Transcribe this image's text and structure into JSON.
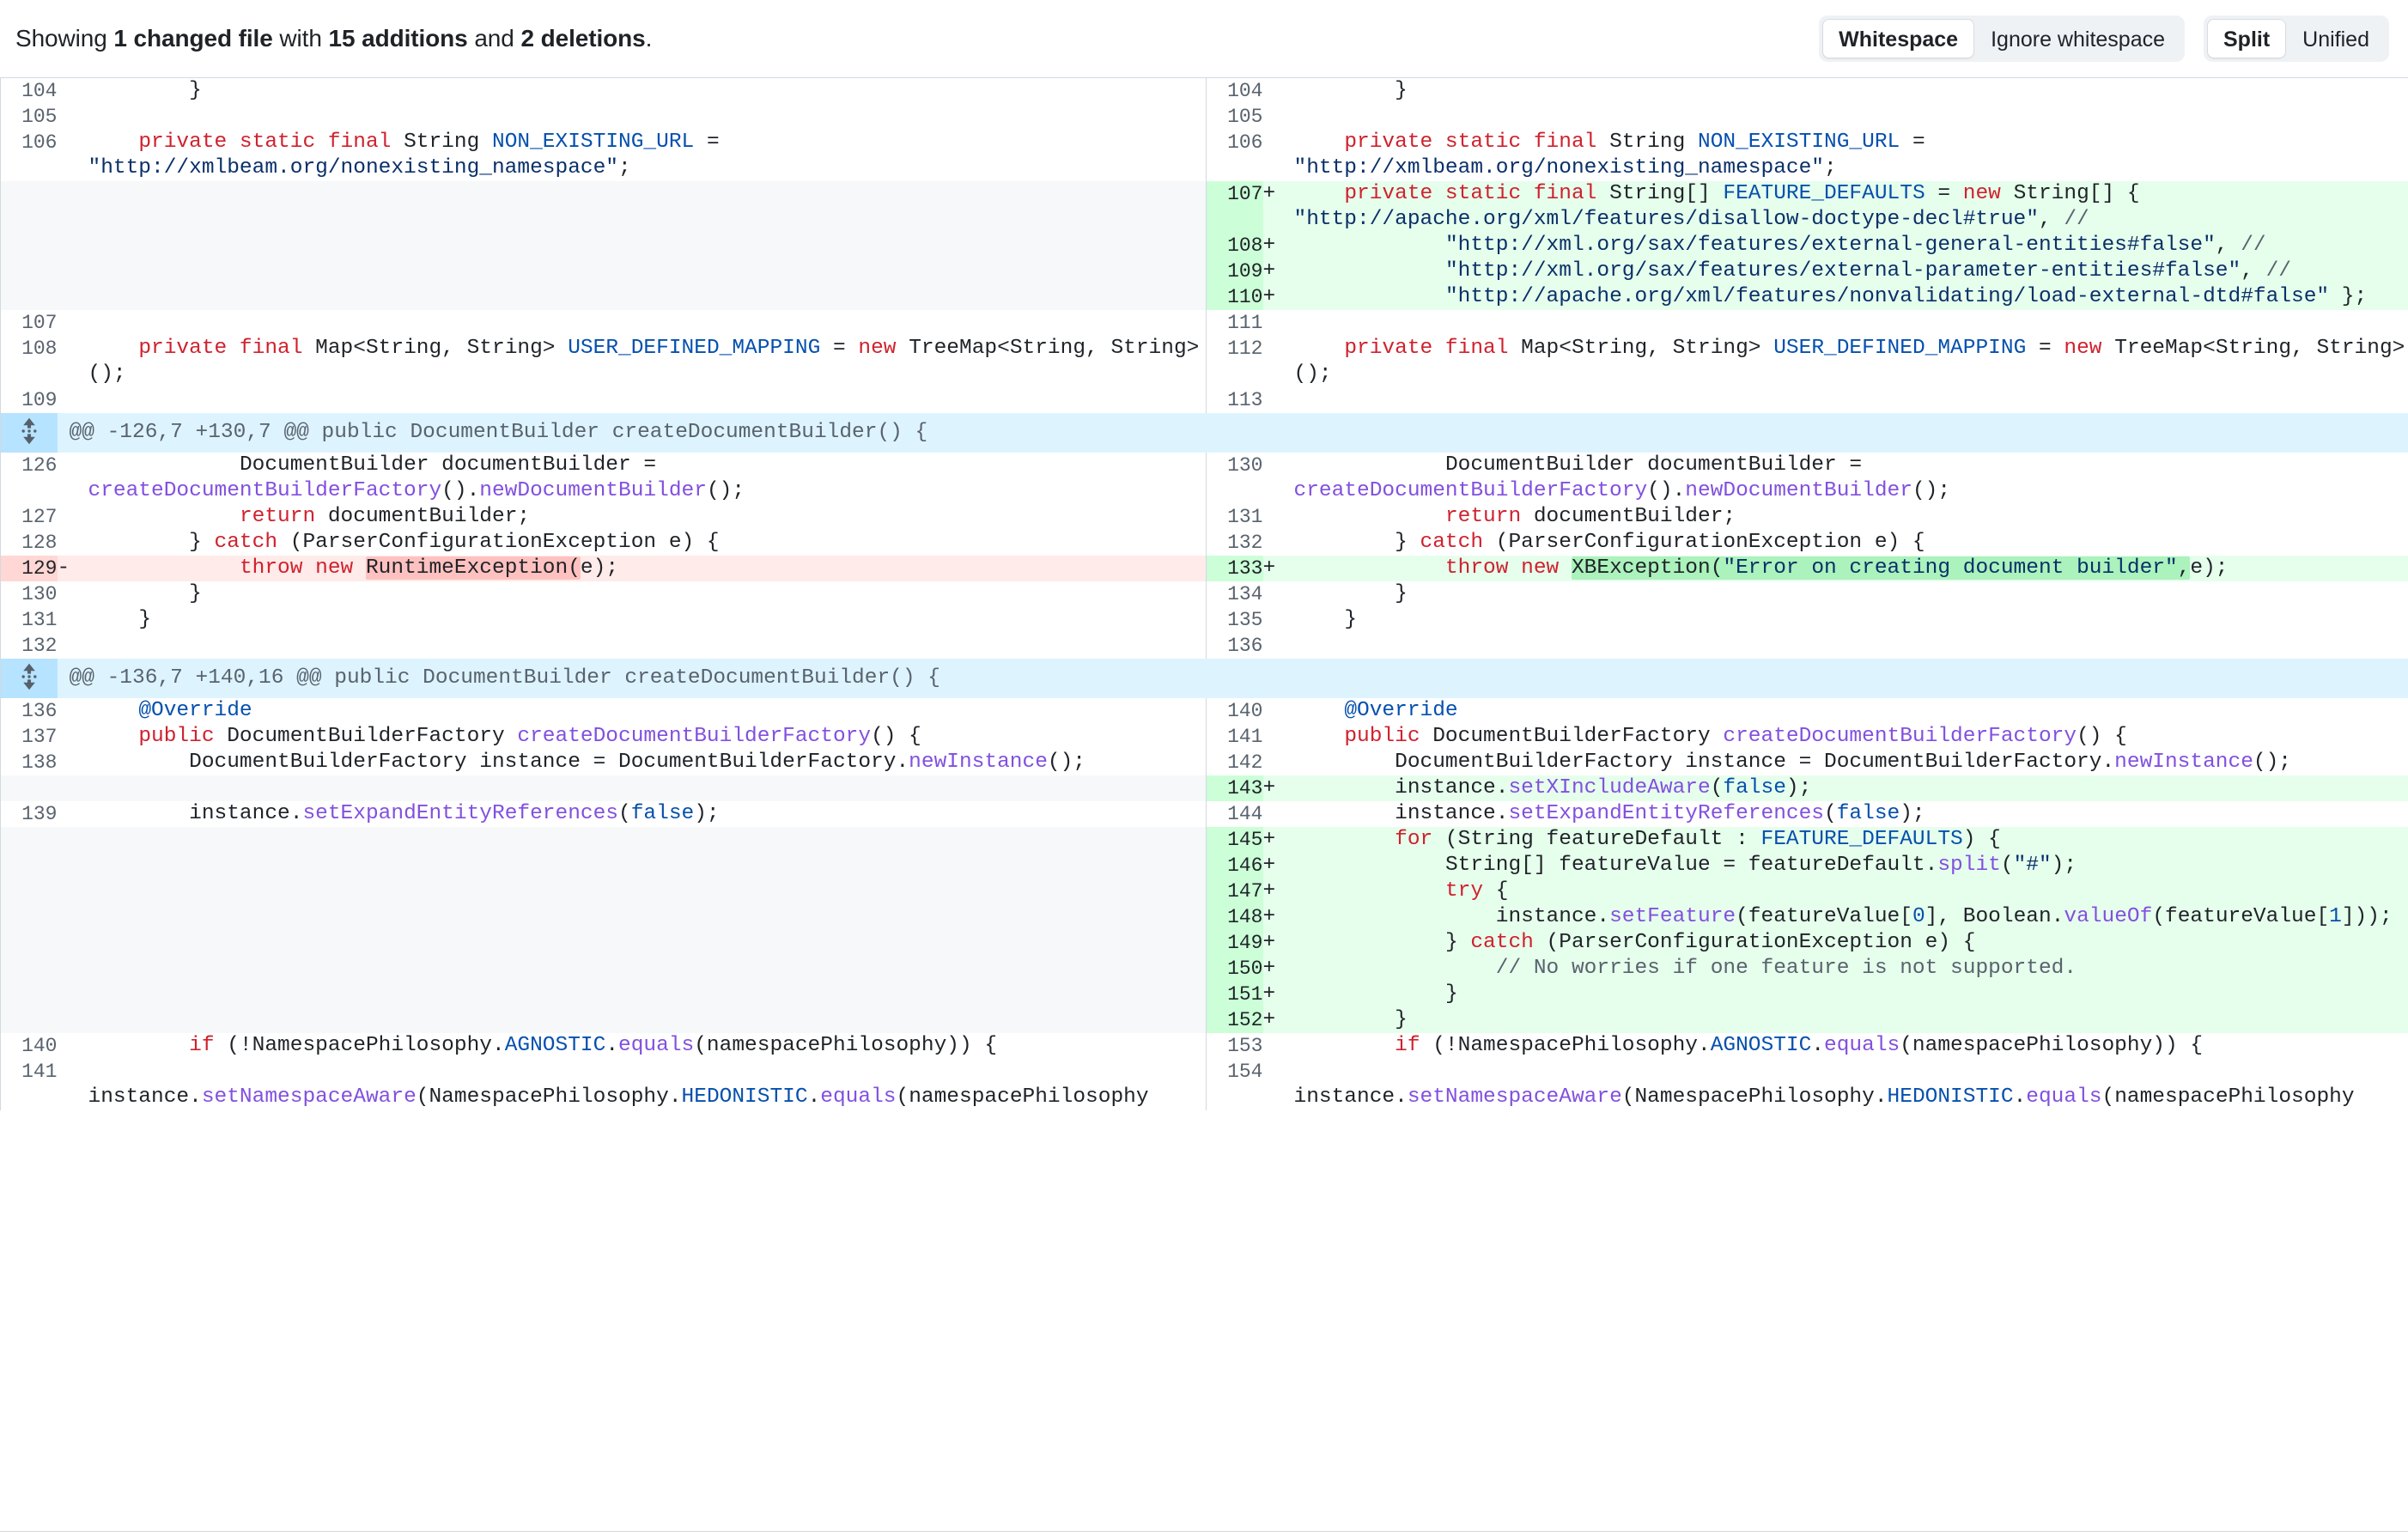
{
  "header": {
    "summary_prefix": "Showing ",
    "summary_files": "1 changed file",
    "summary_mid": " with ",
    "summary_additions": "15 additions",
    "summary_and": " and ",
    "summary_deletions": "2 deletions",
    "summary_suffix": ".",
    "full_summary": "Showing 1 changed file with 15 additions and 2 deletions.",
    "whitespace_group": {
      "active": "Whitespace",
      "inactive": "Ignore whitespace"
    },
    "view_group": {
      "active": "Split",
      "inactive": "Unified"
    }
  },
  "diff": {
    "expand_icon": "expand-up-down-icon",
    "hunk1": "@@ -126,7 +130,7 @@ public DocumentBuilder createDocumentBuilder() {",
    "hunk2": "@@ -136,7 +140,16 @@ public DocumentBuilder createDocumentBuilder() {",
    "add_sign": "+",
    "del_sign": "-",
    "left_numbers": [
      "104",
      "105",
      "106",
      "107",
      "108",
      "109",
      "126",
      "127",
      "128",
      "129",
      "130",
      "131",
      "132",
      "136",
      "137",
      "138",
      "139",
      "140",
      "141"
    ],
    "right_numbers": [
      "104",
      "105",
      "106",
      "107",
      "108",
      "109",
      "110",
      "111",
      "112",
      "113",
      "130",
      "131",
      "132",
      "133",
      "134",
      "135",
      "136",
      "140",
      "141",
      "142",
      "143",
      "144",
      "145",
      "146",
      "147",
      "148",
      "149",
      "150",
      "151",
      "152",
      "153",
      "154"
    ],
    "rows": [
      {
        "ln": "104",
        "rn": "104",
        "text": "        }"
      },
      {
        "ln": "105",
        "rn": "105",
        "text": ""
      },
      {
        "ln": "106",
        "rn": "106",
        "text": "    private static final String NON_EXISTING_URL = \"http://xmlbeam.org/nonexisting_namespace\";"
      },
      {
        "ln": "",
        "rn": "107",
        "text": "    private static final String[] FEATURE_DEFAULTS = new String[] { \"http://apache.org/xml/features/disallow-doctype-decl#true\", //"
      },
      {
        "ln": "",
        "rn": "108",
        "text": "            \"http://xml.org/sax/features/external-general-entities#false\", //"
      },
      {
        "ln": "",
        "rn": "109",
        "text": "            \"http://xml.org/sax/features/external-parameter-entities#false\", //"
      },
      {
        "ln": "",
        "rn": "110",
        "text": "            \"http://apache.org/xml/features/nonvalidating/load-external-dtd#false\" };"
      },
      {
        "ln": "107",
        "rn": "111",
        "text": ""
      },
      {
        "ln": "108",
        "rn": "112",
        "text": "    private final Map<String, String> USER_DEFINED_MAPPING = new TreeMap<String, String>();"
      },
      {
        "ln": "109",
        "rn": "113",
        "text": ""
      },
      {
        "ln": "126",
        "rn": "130",
        "text": "            DocumentBuilder documentBuilder = createDocumentBuilderFactory().newDocumentBuilder();"
      },
      {
        "ln": "127",
        "rn": "131",
        "text": "            return documentBuilder;"
      },
      {
        "ln": "128",
        "rn": "132",
        "text": "        } catch (ParserConfigurationException e) {"
      },
      {
        "ln": "129",
        "rn": "133",
        "text": "            throw new RuntimeException(e);",
        "text_right": "            throw new XBException(\"Error on creating document builder\",e);"
      },
      {
        "ln": "130",
        "rn": "134",
        "text": "        }"
      },
      {
        "ln": "131",
        "rn": "135",
        "text": "    }"
      },
      {
        "ln": "132",
        "rn": "136",
        "text": ""
      },
      {
        "ln": "136",
        "rn": "140",
        "text": "    @Override"
      },
      {
        "ln": "137",
        "rn": "141",
        "text": "    public DocumentBuilderFactory createDocumentBuilderFactory() {"
      },
      {
        "ln": "138",
        "rn": "142",
        "text": "        DocumentBuilderFactory instance = DocumentBuilderFactory.newInstance();"
      },
      {
        "ln": "",
        "rn": "143",
        "text": "        instance.setXIncludeAware(false);"
      },
      {
        "ln": "139",
        "rn": "144",
        "text": "        instance.setExpandEntityReferences(false);"
      },
      {
        "ln": "",
        "rn": "145",
        "text": "        for (String featureDefault : FEATURE_DEFAULTS) {"
      },
      {
        "ln": "",
        "rn": "146",
        "text": "            String[] featureValue = featureDefault.split(\"#\");"
      },
      {
        "ln": "",
        "rn": "147",
        "text": "            try {"
      },
      {
        "ln": "",
        "rn": "148",
        "text": "                instance.setFeature(featureValue[0], Boolean.valueOf(featureValue[1]));"
      },
      {
        "ln": "",
        "rn": "149",
        "text": "            } catch (ParserConfigurationException e) {"
      },
      {
        "ln": "",
        "rn": "150",
        "text": "                // No worries if one feature is not supported."
      },
      {
        "ln": "",
        "rn": "151",
        "text": "            }"
      },
      {
        "ln": "",
        "rn": "152",
        "text": "        }"
      },
      {
        "ln": "140",
        "rn": "153",
        "text": "        if (!NamespacePhilosophy.AGNOSTIC.equals(namespacePhilosophy)) {"
      },
      {
        "ln": "141",
        "rn": "154",
        "text": "            instance.setNamespaceAware(NamespacePhilosophy.HEDONISTIC.equals(namespacePhilosophy"
      }
    ]
  }
}
